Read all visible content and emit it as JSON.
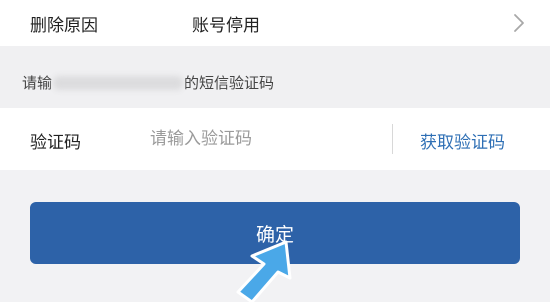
{
  "delete_reason": {
    "label": "删除原因",
    "value": "账号停用",
    "icon": "chevron-right-icon"
  },
  "sms_hint": {
    "prefix": "请输",
    "suffix": "的短信验证码"
  },
  "verify_code": {
    "label": "验证码",
    "placeholder": "请输入验证码",
    "get_code_label": "获取验证码"
  },
  "confirm_button": {
    "label": "确定"
  },
  "colors": {
    "accent": "#2d62a8",
    "link": "#2e6fb5",
    "pointer_arrow": "#4aa8e8"
  }
}
